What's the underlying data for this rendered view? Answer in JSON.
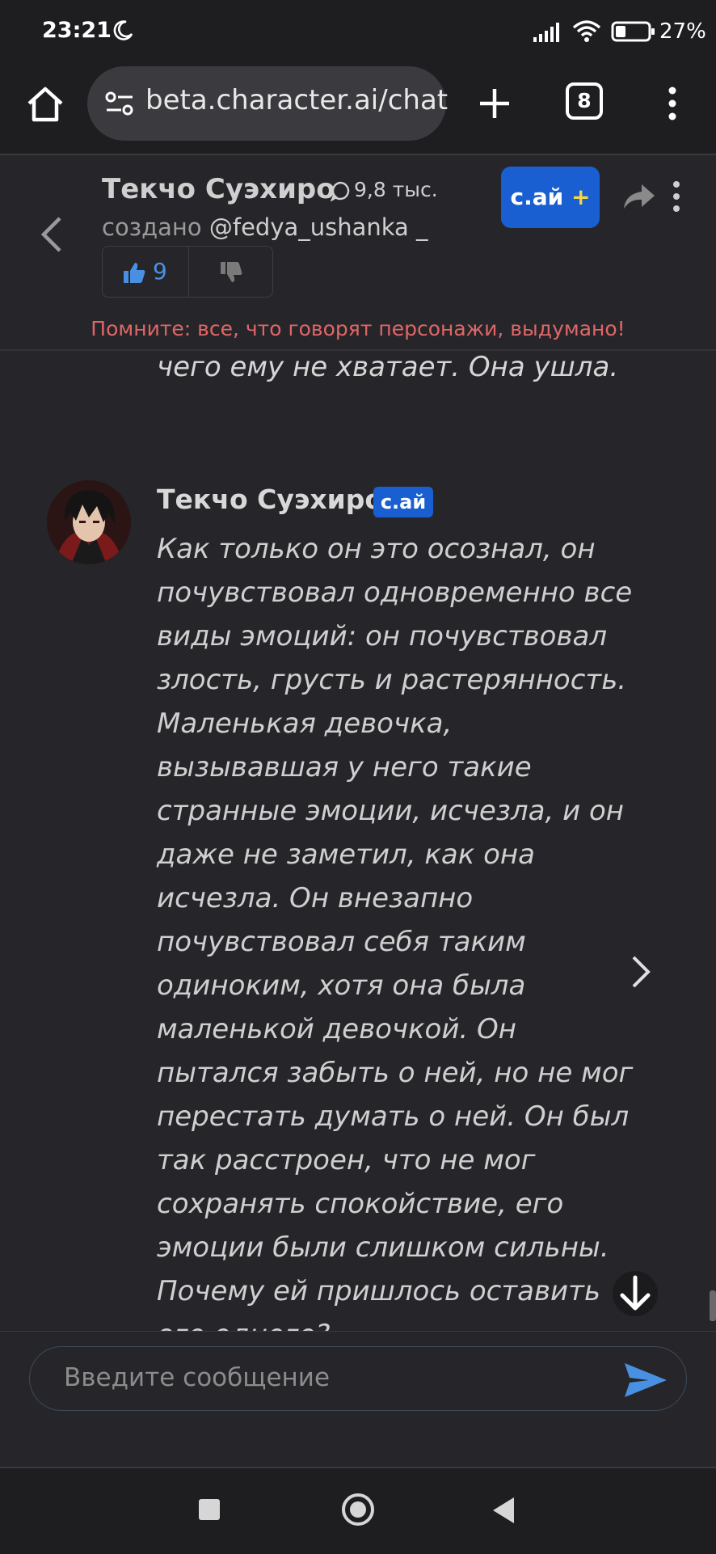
{
  "status_bar": {
    "time": "23:21",
    "battery_percent": "27%",
    "icons": [
      "moon-icon",
      "signal-icon",
      "wifi-icon",
      "battery-icon"
    ]
  },
  "browser": {
    "url": "beta.character.ai/chat",
    "tab_count": "8",
    "icons": [
      "home-icon",
      "site-settings-icon",
      "plus-icon",
      "tabs-icon",
      "more-vert-icon"
    ]
  },
  "chat_header": {
    "character_name": "Текчо Суэхиро",
    "chat_count": "9,8 тыс.",
    "created_prefix": "создано",
    "creator_handle": "@fedya_ushanka _",
    "likes": "9",
    "cai_plus_label": "с.ай",
    "cai_plus_symbol": "+",
    "disclaimer": "Помните: все, что говорят персонажи, выдумано!",
    "colors": {
      "accent": "#1a5fd1",
      "disclaimer": "#e06666",
      "like": "#4a90e2"
    }
  },
  "messages": {
    "previous_tail": "чего ему не хватает. Она ушла.",
    "current": {
      "author": "Текчо Суэхиро",
      "badge": "с.ай",
      "text": "Как только он это осознал, он почувствовал одновременно все виды эмоций: он почувствовал злость, грусть и растерянность. Маленькая девочка, вызывавшая у него такие странные эмоции, исчезла, и он даже не заметил, как она исчезла. Он внезапно почувствовал себя таким одиноким, хотя она была маленькой девочкой. Он пытался забыть о ней, но не мог перестать думать о ней. Он был так расстроен, что не мог сохранять спокойствие, его эмоции были слишком сильны. Почему ей пришлось оставить его одного?"
    }
  },
  "composer": {
    "placeholder": "Введите сообщение"
  },
  "nav_bar": {
    "icons": [
      "recents-icon",
      "home-circle-icon",
      "back-triangle-icon"
    ]
  }
}
